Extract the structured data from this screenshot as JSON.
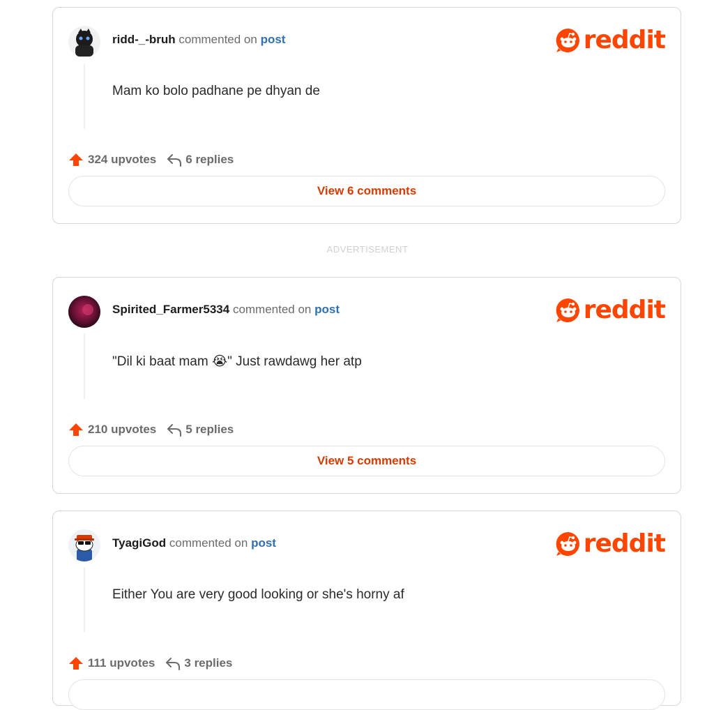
{
  "brand": {
    "logo_text": "reddit",
    "accent_color": "#ff4500",
    "link_color": "#2f6fb2"
  },
  "advertisement_label": "ADVERTISEMENT",
  "comments": [
    {
      "username": "ridd-_-bruh",
      "commented_on": "commented on",
      "post_link": "post",
      "body": "Mam ko bolo padhane pe dhyan de",
      "upvotes": "324 upvotes",
      "replies": "6 replies",
      "view_button": "View 6 comments",
      "avatar_icon": "dark-character-avatar"
    },
    {
      "username": "Spirited_Farmer5334",
      "commented_on": "commented on",
      "post_link": "post",
      "body": "\"Dil ki baat mam 😭\" Just rawdawg her atp",
      "upvotes": "210 upvotes",
      "replies": "5 replies",
      "view_button": "View 5 comments",
      "avatar_icon": "red-purple-blur-avatar"
    },
    {
      "username": "TyagiGod",
      "commented_on": "commented on",
      "post_link": "post",
      "body": "Either You are very good looking or she's horny af",
      "upvotes": "111 upvotes",
      "replies": "3 replies",
      "view_button": "",
      "avatar_icon": "snoo-avatar"
    }
  ]
}
